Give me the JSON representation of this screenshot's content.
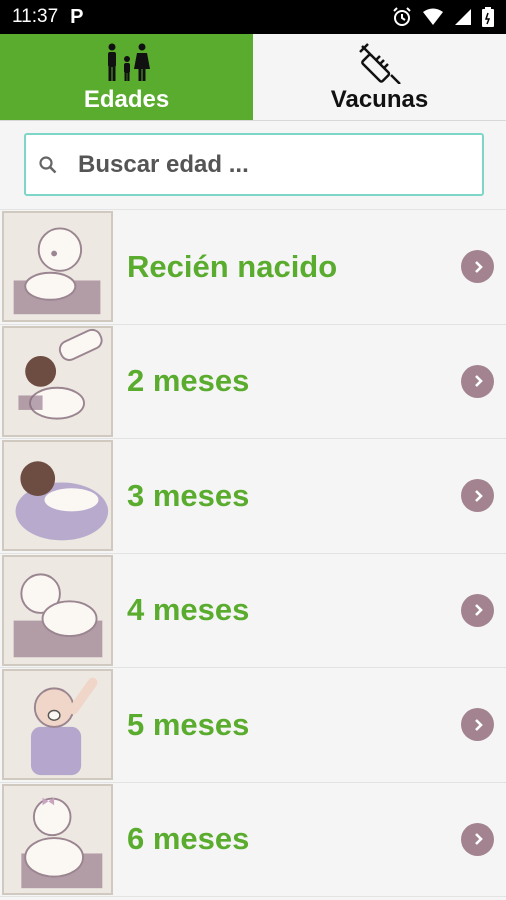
{
  "status_bar": {
    "time": "11:37",
    "app_badge": "P"
  },
  "tabs": [
    {
      "label": "Edades",
      "icon": "family-icon",
      "active": true
    },
    {
      "label": "Vacunas",
      "icon": "syringe-icon",
      "active": false
    }
  ],
  "search": {
    "placeholder": "Buscar edad ...",
    "value": ""
  },
  "items": [
    {
      "label": "Recién nacido",
      "image": "newborn-baby-illustration"
    },
    {
      "label": "2 meses",
      "image": "baby-with-bottle-illustration"
    },
    {
      "label": "3 meses",
      "image": "swaddled-baby-illustration"
    },
    {
      "label": "4 meses",
      "image": "crawling-baby-illustration"
    },
    {
      "label": "5 meses",
      "image": "baby-with-pacifier-illustration"
    },
    {
      "label": "6 meses",
      "image": "sitting-baby-illustration"
    }
  ],
  "colors": {
    "accent": "#5aac2e",
    "chevron": "#a2838f",
    "search_border": "#7ed6c8"
  }
}
